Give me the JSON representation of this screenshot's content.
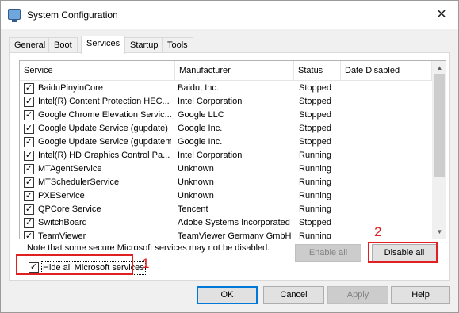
{
  "window": {
    "title": "System Configuration",
    "close_glyph": "✕"
  },
  "tabs": [
    {
      "label": "General"
    },
    {
      "label": "Boot"
    },
    {
      "label": "Services",
      "active": true
    },
    {
      "label": "Startup"
    },
    {
      "label": "Tools"
    }
  ],
  "columns": {
    "service": "Service",
    "manufacturer": "Manufacturer",
    "status": "Status",
    "date_disabled": "Date Disabled"
  },
  "rows": [
    {
      "service": "BaiduPinyinCore",
      "manufacturer": "Baidu, Inc.",
      "status": "Stopped",
      "date_disabled": "",
      "checked": true
    },
    {
      "service": "Intel(R) Content Protection HEC...",
      "manufacturer": "Intel Corporation",
      "status": "Stopped",
      "date_disabled": "",
      "checked": true
    },
    {
      "service": "Google Chrome Elevation Servic...",
      "manufacturer": "Google LLC",
      "status": "Stopped",
      "date_disabled": "",
      "checked": true
    },
    {
      "service": "Google Update Service (gupdate)",
      "manufacturer": "Google Inc.",
      "status": "Stopped",
      "date_disabled": "",
      "checked": true
    },
    {
      "service": "Google Update Service (gupdatem)",
      "manufacturer": "Google Inc.",
      "status": "Stopped",
      "date_disabled": "",
      "checked": true
    },
    {
      "service": "Intel(R) HD Graphics Control Pa...",
      "manufacturer": "Intel Corporation",
      "status": "Running",
      "date_disabled": "",
      "checked": true
    },
    {
      "service": "MTAgentService",
      "manufacturer": "Unknown",
      "status": "Running",
      "date_disabled": "",
      "checked": true
    },
    {
      "service": "MTSchedulerService",
      "manufacturer": "Unknown",
      "status": "Running",
      "date_disabled": "",
      "checked": true
    },
    {
      "service": "PXEService",
      "manufacturer": "Unknown",
      "status": "Running",
      "date_disabled": "",
      "checked": true
    },
    {
      "service": "QPCore Service",
      "manufacturer": "Tencent",
      "status": "Running",
      "date_disabled": "",
      "checked": true
    },
    {
      "service": "SwitchBoard",
      "manufacturer": "Adobe Systems Incorporated",
      "status": "Stopped",
      "date_disabled": "",
      "checked": true
    },
    {
      "service": "TeamViewer",
      "manufacturer": "TeamViewer Germany GmbH",
      "status": "Running",
      "date_disabled": "",
      "checked": true
    }
  ],
  "check_glyph": "✓",
  "note": "Note that some secure Microsoft services may not be disabled.",
  "hide_ms": {
    "label": "Hide all Microsoft services",
    "checked": true
  },
  "buttons": {
    "enable_all": "Enable all",
    "disable_all": "Disable all",
    "ok": "OK",
    "cancel": "Cancel",
    "apply": "Apply",
    "help": "Help"
  },
  "annotations": {
    "one": "1",
    "two": "2",
    "color": "#e02020"
  },
  "scroll": {
    "up_glyph": "▲",
    "down_glyph": "▼"
  }
}
